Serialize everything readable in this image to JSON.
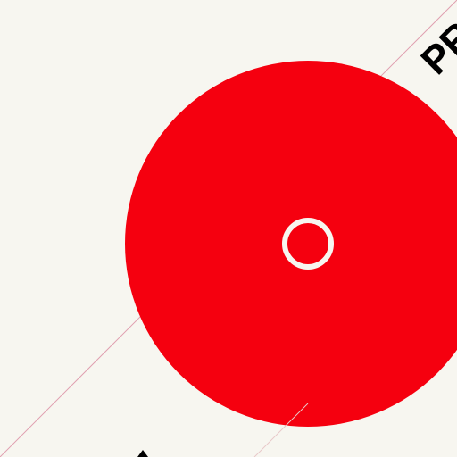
{
  "colors": {
    "background": "#f7f6f0",
    "disc": "#f5000f",
    "center_ring": "#f7f6f0",
    "guide_line": "#e0a0b0",
    "text": "#000000"
  },
  "text": {
    "top_right_fragment": "PR"
  }
}
